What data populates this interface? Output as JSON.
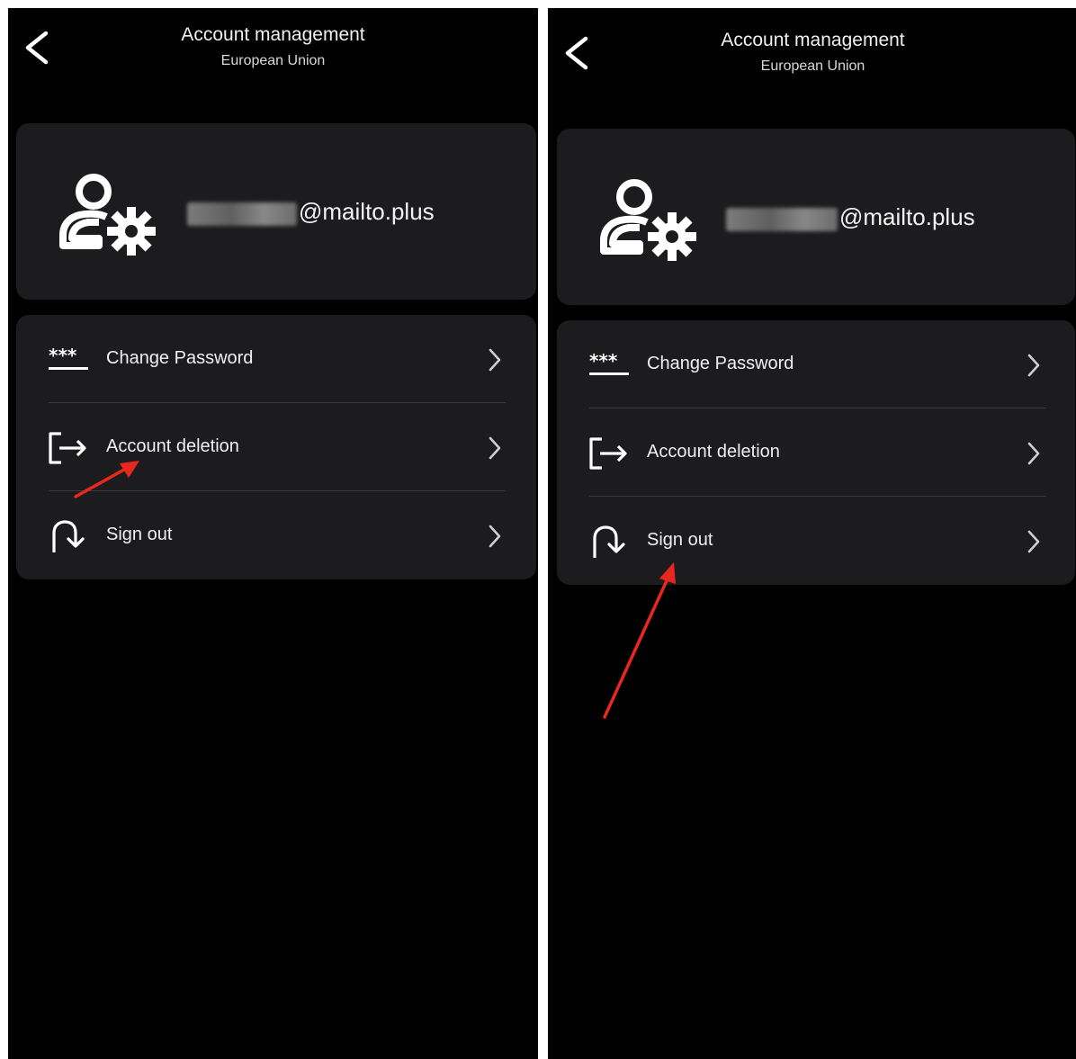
{
  "screens": [
    {
      "header": {
        "title": "Account management",
        "subtitle": "European Union"
      },
      "account": {
        "email_suffix": "@mailto.plus",
        "email_masked": true
      },
      "menu": [
        {
          "label": "Change Password",
          "icon": "password-icon"
        },
        {
          "label": "Account deletion",
          "icon": "logout-box-icon"
        },
        {
          "label": "Sign out",
          "icon": "u-turn-arrow-icon"
        }
      ],
      "annotation": {
        "type": "red-arrow",
        "target": "Account deletion",
        "color": "#e8271f"
      }
    },
    {
      "header": {
        "title": "Account management",
        "subtitle": "European Union"
      },
      "account": {
        "email_suffix": "@mailto.plus",
        "email_masked": true
      },
      "menu": [
        {
          "label": "Change Password",
          "icon": "password-icon"
        },
        {
          "label": "Account deletion",
          "icon": "logout-box-icon"
        },
        {
          "label": "Sign out",
          "icon": "u-turn-arrow-icon"
        }
      ],
      "annotation": {
        "type": "red-arrow",
        "target": "Sign out",
        "color": "#e8271f"
      }
    }
  ],
  "colors": {
    "background": "#000000",
    "card": "#1c1c1e",
    "divider": "#3a3a3c",
    "text": "#f0f0f0"
  }
}
